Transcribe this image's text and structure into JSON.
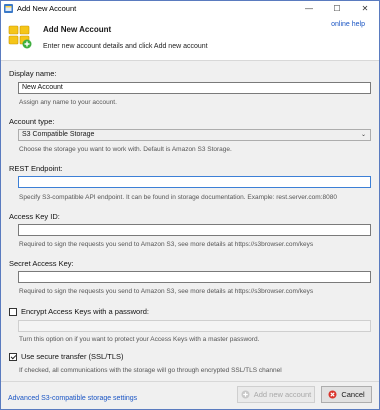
{
  "window": {
    "title": "Add New Account",
    "minimize": "—",
    "maximize": "☐",
    "close": "✕"
  },
  "header": {
    "title": "Add New Account",
    "subtitle": "Enter new account details and click Add new account",
    "online_help": "online help"
  },
  "form": {
    "display_name": {
      "label": "Display name:",
      "value": "New Account",
      "hint": "Assign any name to your account."
    },
    "account_type": {
      "label": "Account type:",
      "selected": "S3 Compatible Storage",
      "hint": "Choose the storage you want to work with. Default is Amazon S3 Storage."
    },
    "rest_endpoint": {
      "label": "REST Endpoint:",
      "value": "",
      "hint": "Specify S3-compatible API endpoint. It can be found in storage documentation. Example: rest.server.com:8080"
    },
    "access_key": {
      "label": "Access Key ID:",
      "value": "",
      "hint": "Required to sign the requests you send to Amazon S3, see more details at https://s3browser.com/keys"
    },
    "secret_key": {
      "label": "Secret Access Key:",
      "value": "",
      "hint": "Required to sign the requests you send to Amazon S3, see more details at https://s3browser.com/keys"
    },
    "encrypt": {
      "label": "Encrypt Access Keys with a password:",
      "checked": false,
      "value": "",
      "hint": "Turn this option on if you want to protect your Access Keys with a master password."
    },
    "ssl": {
      "label": "Use secure transfer (SSL/TLS)",
      "checked": true,
      "hint": "If checked, all communications with the storage will go through encrypted SSL/TLS channel"
    }
  },
  "footer": {
    "advanced_link": "Advanced S3-compatible storage settings",
    "add_button": "Add new account",
    "cancel_button": "Cancel"
  }
}
